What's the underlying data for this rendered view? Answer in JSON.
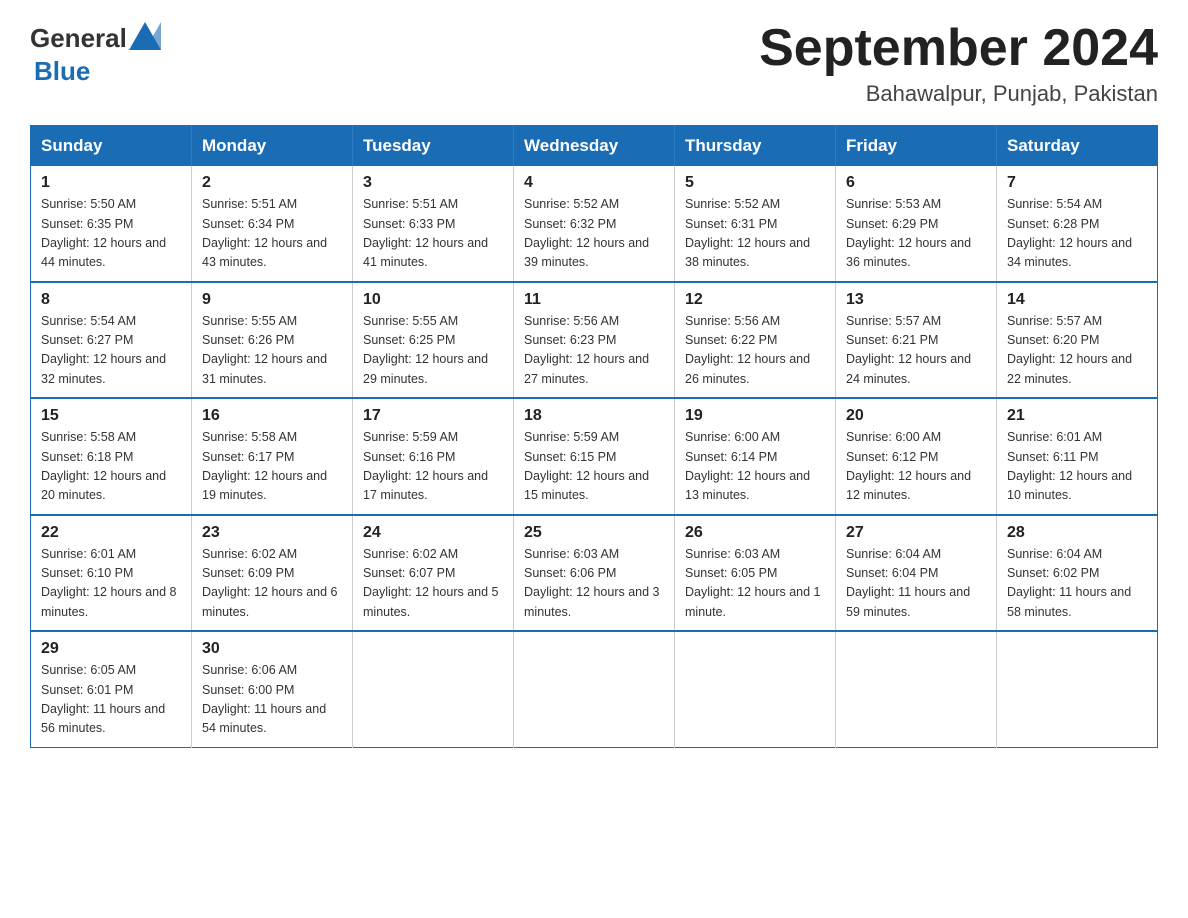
{
  "header": {
    "title": "September 2024",
    "subtitle": "Bahawalpur, Punjab, Pakistan",
    "logo_general": "General",
    "logo_blue": "Blue"
  },
  "days_of_week": [
    "Sunday",
    "Monday",
    "Tuesday",
    "Wednesday",
    "Thursday",
    "Friday",
    "Saturday"
  ],
  "weeks": [
    [
      {
        "day": "1",
        "sunrise": "Sunrise: 5:50 AM",
        "sunset": "Sunset: 6:35 PM",
        "daylight": "Daylight: 12 hours and 44 minutes."
      },
      {
        "day": "2",
        "sunrise": "Sunrise: 5:51 AM",
        "sunset": "Sunset: 6:34 PM",
        "daylight": "Daylight: 12 hours and 43 minutes."
      },
      {
        "day": "3",
        "sunrise": "Sunrise: 5:51 AM",
        "sunset": "Sunset: 6:33 PM",
        "daylight": "Daylight: 12 hours and 41 minutes."
      },
      {
        "day": "4",
        "sunrise": "Sunrise: 5:52 AM",
        "sunset": "Sunset: 6:32 PM",
        "daylight": "Daylight: 12 hours and 39 minutes."
      },
      {
        "day": "5",
        "sunrise": "Sunrise: 5:52 AM",
        "sunset": "Sunset: 6:31 PM",
        "daylight": "Daylight: 12 hours and 38 minutes."
      },
      {
        "day": "6",
        "sunrise": "Sunrise: 5:53 AM",
        "sunset": "Sunset: 6:29 PM",
        "daylight": "Daylight: 12 hours and 36 minutes."
      },
      {
        "day": "7",
        "sunrise": "Sunrise: 5:54 AM",
        "sunset": "Sunset: 6:28 PM",
        "daylight": "Daylight: 12 hours and 34 minutes."
      }
    ],
    [
      {
        "day": "8",
        "sunrise": "Sunrise: 5:54 AM",
        "sunset": "Sunset: 6:27 PM",
        "daylight": "Daylight: 12 hours and 32 minutes."
      },
      {
        "day": "9",
        "sunrise": "Sunrise: 5:55 AM",
        "sunset": "Sunset: 6:26 PM",
        "daylight": "Daylight: 12 hours and 31 minutes."
      },
      {
        "day": "10",
        "sunrise": "Sunrise: 5:55 AM",
        "sunset": "Sunset: 6:25 PM",
        "daylight": "Daylight: 12 hours and 29 minutes."
      },
      {
        "day": "11",
        "sunrise": "Sunrise: 5:56 AM",
        "sunset": "Sunset: 6:23 PM",
        "daylight": "Daylight: 12 hours and 27 minutes."
      },
      {
        "day": "12",
        "sunrise": "Sunrise: 5:56 AM",
        "sunset": "Sunset: 6:22 PM",
        "daylight": "Daylight: 12 hours and 26 minutes."
      },
      {
        "day": "13",
        "sunrise": "Sunrise: 5:57 AM",
        "sunset": "Sunset: 6:21 PM",
        "daylight": "Daylight: 12 hours and 24 minutes."
      },
      {
        "day": "14",
        "sunrise": "Sunrise: 5:57 AM",
        "sunset": "Sunset: 6:20 PM",
        "daylight": "Daylight: 12 hours and 22 minutes."
      }
    ],
    [
      {
        "day": "15",
        "sunrise": "Sunrise: 5:58 AM",
        "sunset": "Sunset: 6:18 PM",
        "daylight": "Daylight: 12 hours and 20 minutes."
      },
      {
        "day": "16",
        "sunrise": "Sunrise: 5:58 AM",
        "sunset": "Sunset: 6:17 PM",
        "daylight": "Daylight: 12 hours and 19 minutes."
      },
      {
        "day": "17",
        "sunrise": "Sunrise: 5:59 AM",
        "sunset": "Sunset: 6:16 PM",
        "daylight": "Daylight: 12 hours and 17 minutes."
      },
      {
        "day": "18",
        "sunrise": "Sunrise: 5:59 AM",
        "sunset": "Sunset: 6:15 PM",
        "daylight": "Daylight: 12 hours and 15 minutes."
      },
      {
        "day": "19",
        "sunrise": "Sunrise: 6:00 AM",
        "sunset": "Sunset: 6:14 PM",
        "daylight": "Daylight: 12 hours and 13 minutes."
      },
      {
        "day": "20",
        "sunrise": "Sunrise: 6:00 AM",
        "sunset": "Sunset: 6:12 PM",
        "daylight": "Daylight: 12 hours and 12 minutes."
      },
      {
        "day": "21",
        "sunrise": "Sunrise: 6:01 AM",
        "sunset": "Sunset: 6:11 PM",
        "daylight": "Daylight: 12 hours and 10 minutes."
      }
    ],
    [
      {
        "day": "22",
        "sunrise": "Sunrise: 6:01 AM",
        "sunset": "Sunset: 6:10 PM",
        "daylight": "Daylight: 12 hours and 8 minutes."
      },
      {
        "day": "23",
        "sunrise": "Sunrise: 6:02 AM",
        "sunset": "Sunset: 6:09 PM",
        "daylight": "Daylight: 12 hours and 6 minutes."
      },
      {
        "day": "24",
        "sunrise": "Sunrise: 6:02 AM",
        "sunset": "Sunset: 6:07 PM",
        "daylight": "Daylight: 12 hours and 5 minutes."
      },
      {
        "day": "25",
        "sunrise": "Sunrise: 6:03 AM",
        "sunset": "Sunset: 6:06 PM",
        "daylight": "Daylight: 12 hours and 3 minutes."
      },
      {
        "day": "26",
        "sunrise": "Sunrise: 6:03 AM",
        "sunset": "Sunset: 6:05 PM",
        "daylight": "Daylight: 12 hours and 1 minute."
      },
      {
        "day": "27",
        "sunrise": "Sunrise: 6:04 AM",
        "sunset": "Sunset: 6:04 PM",
        "daylight": "Daylight: 11 hours and 59 minutes."
      },
      {
        "day": "28",
        "sunrise": "Sunrise: 6:04 AM",
        "sunset": "Sunset: 6:02 PM",
        "daylight": "Daylight: 11 hours and 58 minutes."
      }
    ],
    [
      {
        "day": "29",
        "sunrise": "Sunrise: 6:05 AM",
        "sunset": "Sunset: 6:01 PM",
        "daylight": "Daylight: 11 hours and 56 minutes."
      },
      {
        "day": "30",
        "sunrise": "Sunrise: 6:06 AM",
        "sunset": "Sunset: 6:00 PM",
        "daylight": "Daylight: 11 hours and 54 minutes."
      },
      null,
      null,
      null,
      null,
      null
    ]
  ]
}
